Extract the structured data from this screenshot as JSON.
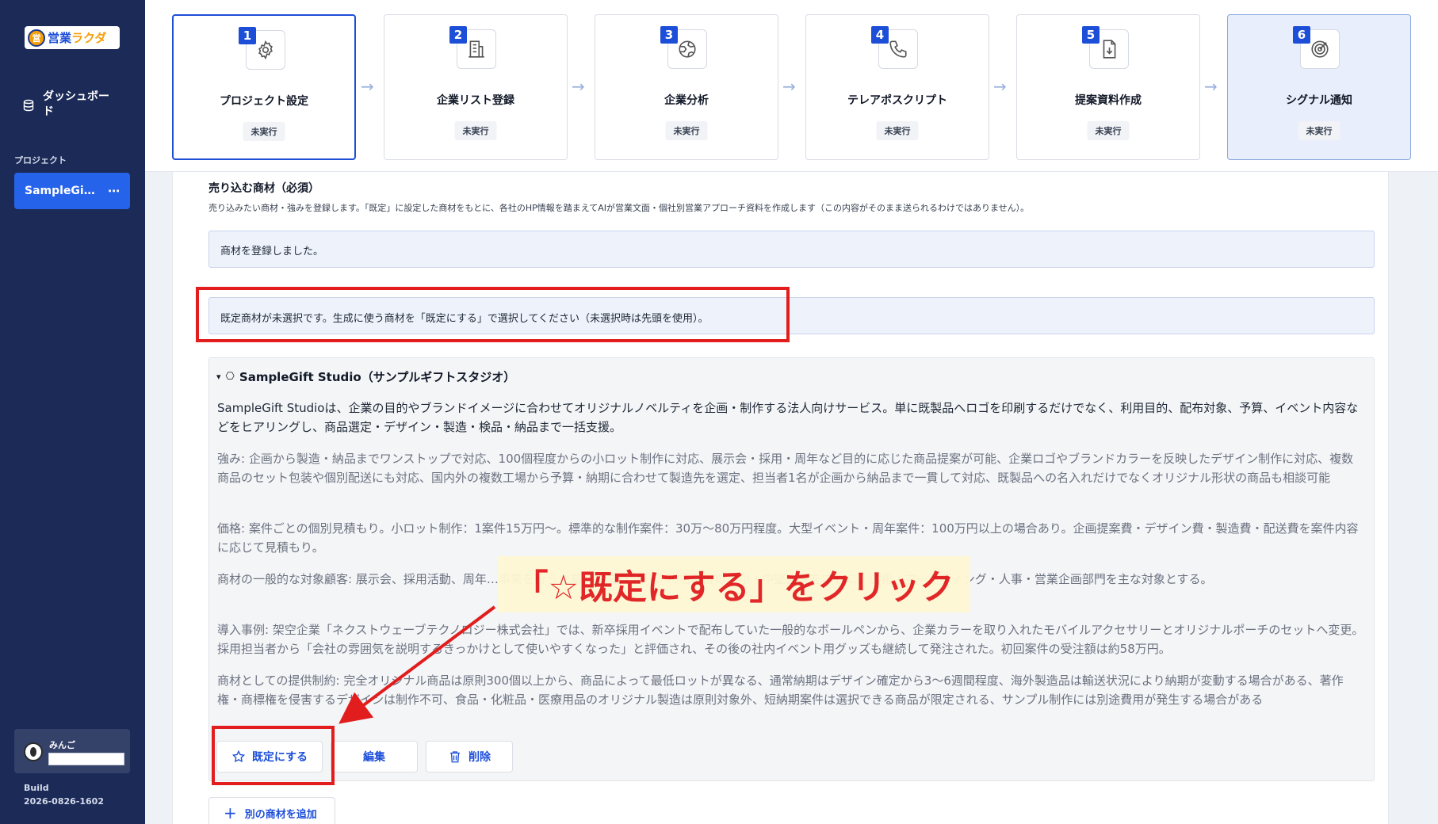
{
  "app": {
    "logo_mark": "営",
    "logo_text_a": "営業",
    "logo_text_b": "ラクダ"
  },
  "sidebar": {
    "dashboard_label": "ダッシュボード",
    "project_heading": "プロジェクト",
    "project_name": "SampleGi…",
    "project_more": "⋯",
    "user_name": "みんご",
    "build_label": "Build",
    "build_version": "2026-0826-1602"
  },
  "steps": [
    {
      "num": "1",
      "title": "プロジェクト設定",
      "status": "未実行",
      "icon": "gear-icon"
    },
    {
      "num": "2",
      "title": "企業リスト登録",
      "status": "未実行",
      "icon": "building-list-icon"
    },
    {
      "num": "3",
      "title": "企業分析",
      "status": "未実行",
      "icon": "globe-icon"
    },
    {
      "num": "4",
      "title": "テレアポスクリプト",
      "status": "未実行",
      "icon": "phone-icon"
    },
    {
      "num": "5",
      "title": "提案資料作成",
      "status": "未実行",
      "icon": "document-download-icon"
    },
    {
      "num": "6",
      "title": "シグナル通知",
      "status": "未実行",
      "icon": "target-icon"
    }
  ],
  "section": {
    "title": "売り込む商材（必須）",
    "description": "売り込みたい商材・強みを登録します。「既定」に設定した商材をもとに、各社のHP情報を踏まえてAIが営業文面・個社別営業アプローチ資料を作成します（この内容がそのまま送られるわけではありません）。",
    "registered_notice": "商材を登録しました。",
    "default_notice": "既定商材が未選択です。生成に使う商材を「既定にする」で選択してください（未選択時は先頭を使用）。"
  },
  "product": {
    "toggle": "▾",
    "cube": "⎔",
    "name": "SampleGift Studio（サンプルギフトスタジオ）",
    "summary": "SampleGift Studioは、企業の目的やブランドイメージに合わせてオリジナルノベルティを企画・制作する法人向けサービス。単に既製品へロゴを印刷するだけでなく、利用目的、配布対象、予算、イベント内容などをヒアリングし、商品選定・デザイン・製造・検品・納品まで一括支援。",
    "strengths": "強み: 企画から製造・納品までワンストップで対応、100個程度からの小ロット制作に対応、展示会・採用・周年など目的に応じた商品提案が可能、企業ロゴやブランドカラーを反映したデザイン制作に対応、複数商品のセット包装や個別配送にも対応、国内外の複数工場から予算・納期に合わせて製造先を選定、担当者1名が企画から納品まで一貫して対応、既製品への名入れだけでなくオリジナル形状の商品も相談可能",
    "price": "価格: 案件ごとの個別見積もり。小ロット制作：1案件15万円〜。標準的な制作案件：30万〜80万円程度。大型イベント・周年案件：100万円以上の場合あり。企画提案費・デザイン費・製造費・配送費を案件内容に応じて見積もり。",
    "targets": "商材の一般的な対象顧客: 展示会、採用活動、周年…事業を行う企業。従業員50〜500名程度の中小・中堅企業を中心に、広報・マーケティング・人事・営業企画部門を主な対象とする。",
    "case": "導入事例: 架空企業「ネクストウェーブテクノロジー株式会社」では、新卒採用イベントで配布していた一般的なボールペンから、企業カラーを取り入れたモバイルアクセサリーとオリジナルポーチのセットへ変更。採用担当者から「会社の雰囲気を説明するきっかけとして使いやすくなった」と評価され、その後の社内イベント用グッズも継続して発注された。初回案件の受注額は約58万円。",
    "constraints": "商材としての提供制約: 完全オリジナル商品は原則300個以上から、商品によって最低ロットが異なる、通常納期はデザイン確定から3〜6週間程度、海外製造品は輸送状況により納期が変動する場合がある、著作権・商標権を侵害するデザインは制作不可、食品・化粧品・医療用品のオリジナル製造は原則対象外、短納期案件は選択できる商品が限定される、サンプル制作には別途費用が発生する場合がある"
  },
  "buttons": {
    "set_default": "既定にする",
    "edit": "編集",
    "delete": "削除",
    "add_product": "別の商材を追加",
    "add_plus": "+"
  },
  "annotation": {
    "callout": "「☆既定にする」をクリック",
    "color": "#e11d1d"
  }
}
